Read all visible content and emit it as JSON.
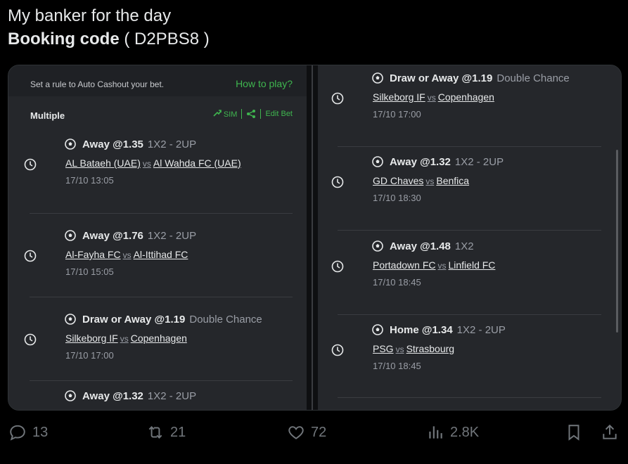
{
  "post": {
    "line1": "My banker for the day",
    "line2_bold": "Booking code",
    "line2_rest": " ( D2PBS8 )"
  },
  "slip": {
    "rule_text": "Set a rule to Auto Cashout your bet.",
    "how_to_play": "How to play?",
    "multiple": "Multiple",
    "sim": "SIM",
    "edit_bet": "Edit Bet",
    "vs": "vs"
  },
  "left_bets": [
    {
      "sel": "Away @1.35",
      "market": "1X2  -  2UP",
      "home": "AL Bataeh (UAE)",
      "away": "Al Wahda FC (UAE)",
      "time": "17/10 13:05"
    },
    {
      "sel": "Away @1.76",
      "market": "1X2  -  2UP",
      "home": "Al-Fayha FC",
      "away": "Al-Ittihad FC",
      "time": "17/10 15:05"
    },
    {
      "sel": "Draw or Away @1.19",
      "market": "Double Chance",
      "home": "Silkeborg IF",
      "away": "Copenhagen",
      "time": "17/10 17:00"
    },
    {
      "sel": "Away @1.32",
      "market": "1X2  -  2UP",
      "home": "",
      "away": "",
      "time": ""
    }
  ],
  "right_bets": [
    {
      "sel": "Draw or Away @1.19",
      "market": "Double Chance",
      "home": "Silkeborg IF",
      "away": "Copenhagen",
      "time": "17/10 17:00"
    },
    {
      "sel": "Away @1.32",
      "market": "1X2  -  2UP",
      "home": "GD Chaves",
      "away": "Benfica",
      "time": "17/10 18:30"
    },
    {
      "sel": "Away @1.48",
      "market": "1X2",
      "home": "Portadown FC",
      "away": "Linfield FC",
      "time": "17/10 18:45"
    },
    {
      "sel": "Home @1.34",
      "market": "1X2  -  2UP",
      "home": "PSG",
      "away": "Strasbourg",
      "time": "17/10 18:45"
    }
  ],
  "actions": {
    "replies": "13",
    "reposts": "21",
    "likes": "72",
    "views": "2.8K"
  },
  "colors": {
    "accent_green": "#3fb64f",
    "panel": "#25272b",
    "muted": "#9a9ea6"
  }
}
